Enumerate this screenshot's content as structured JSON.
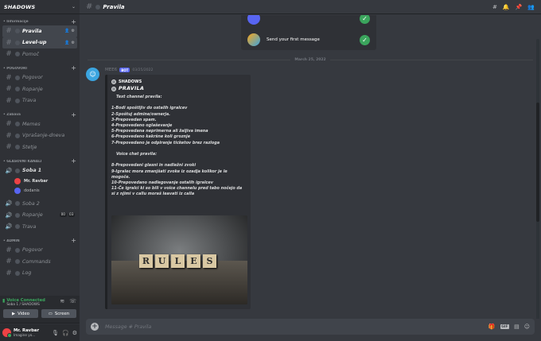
{
  "guild": {
    "name": "SHADOWS"
  },
  "sidebar": {
    "categories": [
      {
        "label": "Informacije",
        "channels": [
          {
            "name": "Pravila",
            "active": true
          },
          {
            "name": "Level-up",
            "active": false,
            "highlight": true
          },
          {
            "name": "Pomoč",
            "active": false
          }
        ]
      },
      {
        "label": "POGOVORI",
        "channels": [
          {
            "name": "Pogovor"
          },
          {
            "name": "Ropanje"
          },
          {
            "name": "Trava"
          }
        ]
      },
      {
        "label": "Zabava",
        "channels": [
          {
            "name": "Memes"
          },
          {
            "name": "Vprašanje-dneva"
          },
          {
            "name": "Štetje"
          }
        ]
      }
    ],
    "voice_category": {
      "label": "GLASOVNI KANALI"
    },
    "voice_channels": [
      {
        "name": "Soba 1",
        "active": true,
        "users": [
          {
            "name": "Mr. Ravbar"
          },
          {
            "name": "dodanis"
          }
        ]
      },
      {
        "name": "Soba 2"
      },
      {
        "name": "Ropanje",
        "badges": [
          "00",
          "03"
        ]
      },
      {
        "name": "Trava"
      }
    ],
    "admin_category": {
      "label": "ADMIN",
      "channels": [
        {
          "name": "Pogovor"
        },
        {
          "name": "Commands"
        },
        {
          "name": "Log"
        }
      ]
    }
  },
  "voice_panel": {
    "title": "Voice Connected",
    "subtitle": "Soba 1 / SHADOWS",
    "video_label": "Video",
    "screen_label": "Screen"
  },
  "user_panel": {
    "name": "Mr. Ravbar",
    "status": "Imagine yo..."
  },
  "header": {
    "channel": "Pravila"
  },
  "welcome": {
    "row2": "Send your first message"
  },
  "date_divider": "March 25, 2022",
  "message": {
    "author": "MEE6",
    "bot_tag": "BOT",
    "time": "03/25/2022",
    "embed": {
      "author": "SHADOWS",
      "title": "PRAVILA",
      "lines": [
        {
          "text": "Text channel pravila:",
          "heading": true
        },
        {
          "text": ""
        },
        {
          "text": "1-Bodi spoštljiv do ostalih igralcev"
        },
        {
          "text": "2-Spoštuj admine/ownerja."
        },
        {
          "text": "3-Prepovedan spam."
        },
        {
          "text": "4-Prepovedano oglaševanje"
        },
        {
          "text": "5-Prepovedana neprimerna ali žaljiva imena"
        },
        {
          "text": "6-Prepovedano kakršne koli groznje"
        },
        {
          "text": "7-Prepovedano je odpiranje ticketov brez razloga"
        },
        {
          "text": ""
        },
        {
          "text": "Voice chat pravila:",
          "heading": true
        },
        {
          "text": ""
        },
        {
          "text": "8-Prepovedani glasni in nadležni zvoki"
        },
        {
          "text": "9-Igralec mora zmanjšati zvoke iz ozadja kolikor je le"
        },
        {
          "text": "mogoče."
        },
        {
          "text": "10-Prepovedano nadlegovanje ostalih igralcev"
        },
        {
          "text": "11-Če igralci ki so bili v voice channelu pred tabo nočejo da"
        },
        {
          "text": "si z njimi v callu moraš leavati iz calla"
        }
      ],
      "image_tiles": [
        "R",
        "U",
        "L",
        "E",
        "S"
      ]
    }
  },
  "composer": {
    "placeholder": "Message #  Pravila",
    "gif_label": "GIF"
  }
}
